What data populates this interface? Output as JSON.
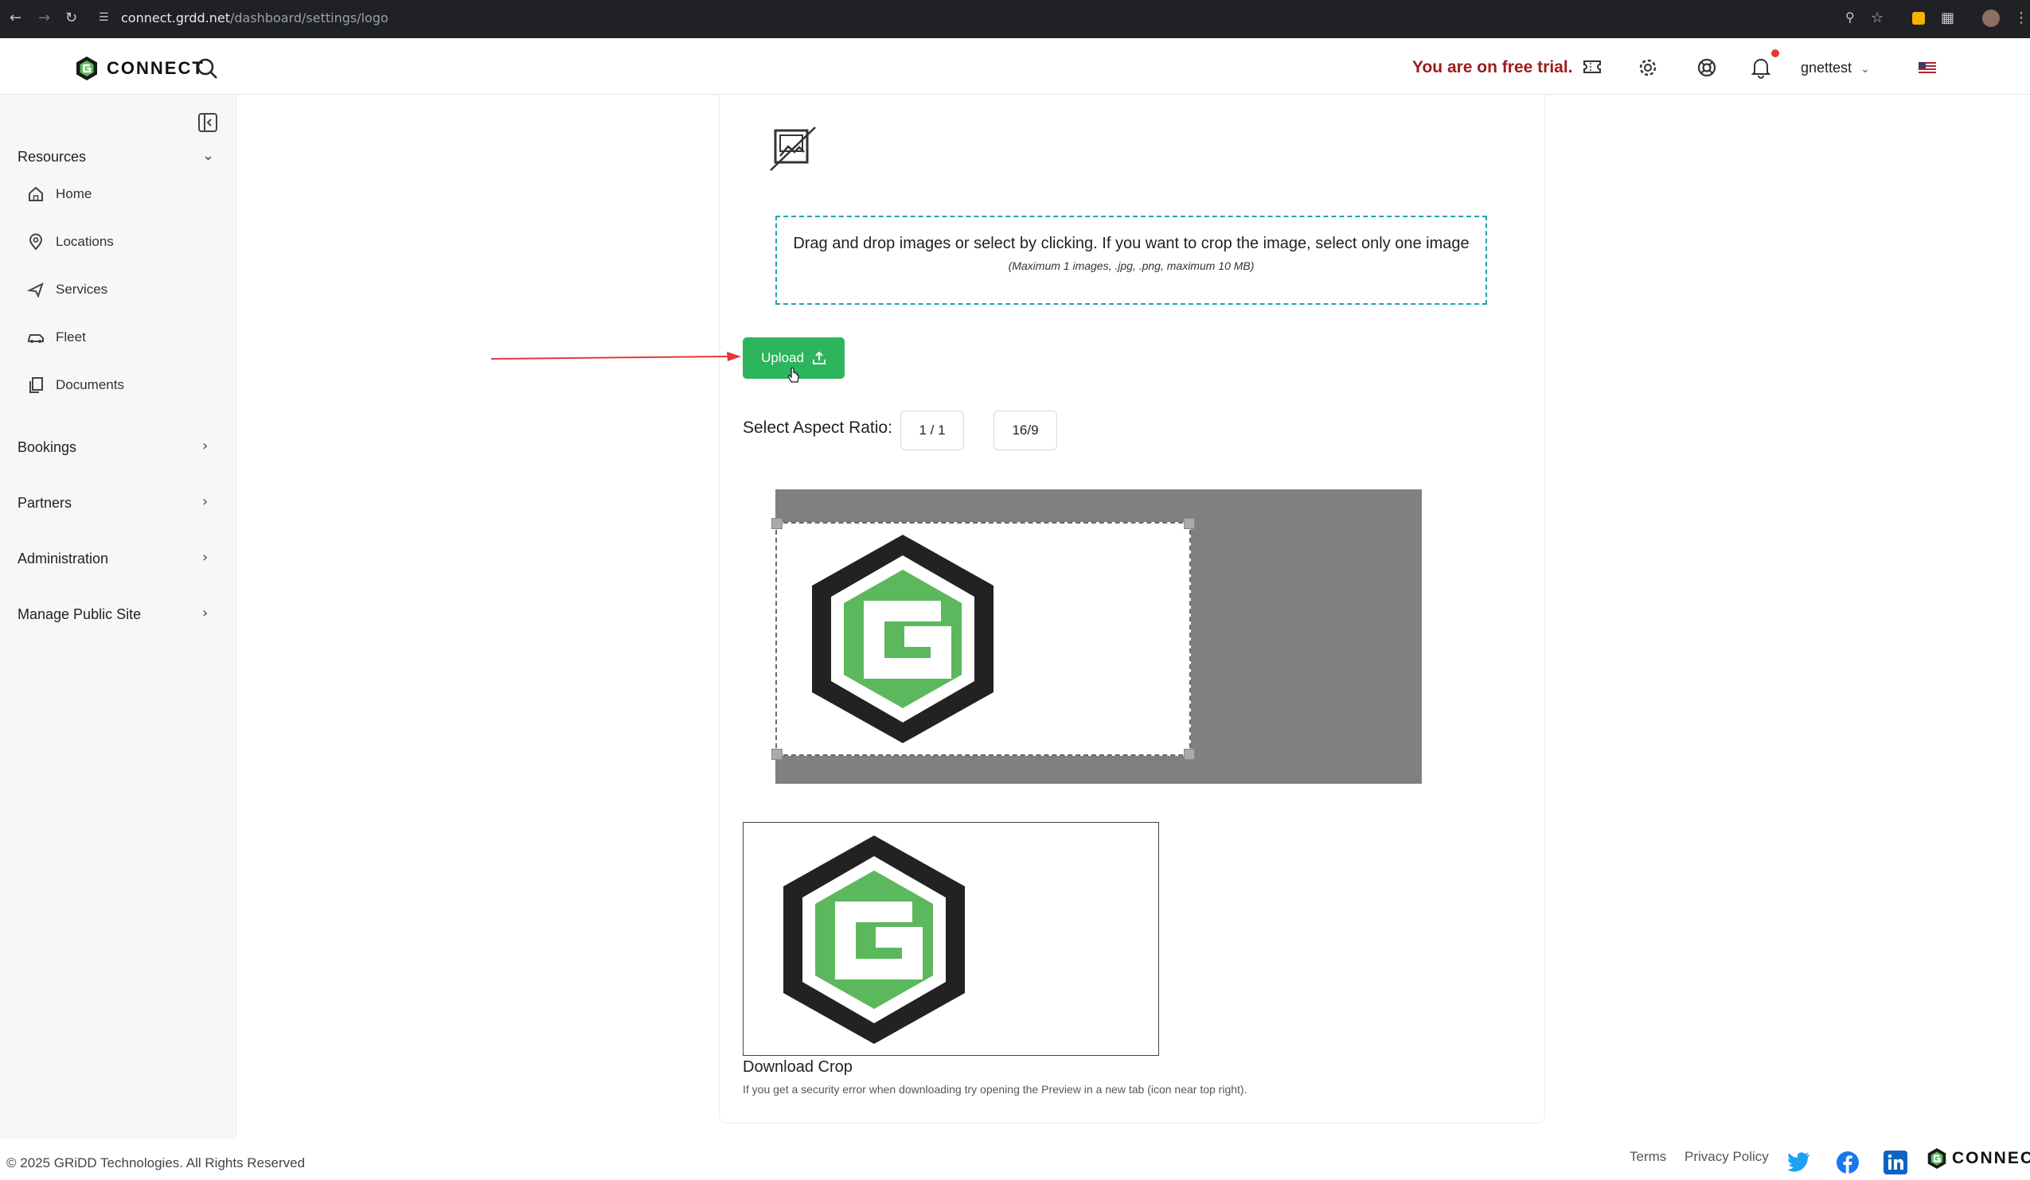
{
  "browser": {
    "url_host": "connect.grdd.net",
    "url_path": "/dashboard/settings/logo"
  },
  "header": {
    "brand": "CONNECT",
    "trial_text": "You are on free trial.",
    "user_name": "gnettest"
  },
  "sidebar": {
    "resources_label": "Resources",
    "items": [
      {
        "label": "Home",
        "icon": "home-icon"
      },
      {
        "label": "Locations",
        "icon": "map-pin-icon"
      },
      {
        "label": "Services",
        "icon": "plane-icon"
      },
      {
        "label": "Fleet",
        "icon": "car-icon"
      },
      {
        "label": "Documents",
        "icon": "documents-icon"
      }
    ],
    "groups": [
      {
        "label": "Bookings"
      },
      {
        "label": "Partners"
      },
      {
        "label": "Administration"
      },
      {
        "label": "Manage Public Site"
      }
    ]
  },
  "main": {
    "dropzone_text": "Drag and drop images or select by clicking. If you want to crop the image, select only one image",
    "dropzone_hint": "(Maximum 1 images, .jpg, .png, maximum 10 MB)",
    "upload_label": "Upload",
    "aspect_label": "Select Aspect Ratio:",
    "ratio_options": [
      "1 / 1",
      "16/9"
    ],
    "download_crop": "Download Crop",
    "download_note": "If you get a security error when downloading try opening the Preview in a new tab (icon near top right)."
  },
  "footer": {
    "copyright": "© 2025 GRiDD Technologies. All Rights Reserved",
    "terms": "Terms",
    "privacy": "Privacy Policy",
    "brand": "CONNECT"
  },
  "colors": {
    "accent_green": "#2db55d",
    "trial_red": "#9b1c1c",
    "dropzone_border": "#1fa4b5",
    "logo_green": "#5cb85c"
  }
}
